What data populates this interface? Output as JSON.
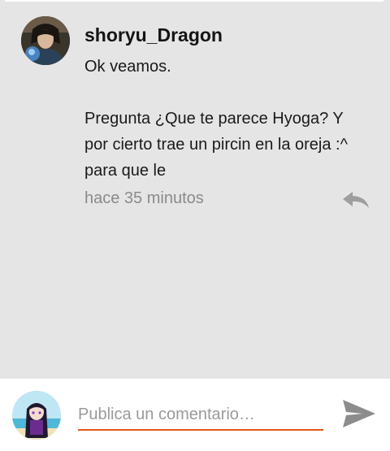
{
  "comment": {
    "username": "shoryu_Dragon",
    "lines": [
      "Ok veamos.",
      "",
      "Pregunta ¿Que te parece Hyoga? Y por cierto trae un pircin en la oreja :^ para que le"
    ],
    "timestamp": "hace 35 minutos",
    "reply_icon": "reply-arrow-icon"
  },
  "composer": {
    "placeholder": "Publica un comentario…",
    "value": "",
    "send_icon": "send-icon"
  },
  "colors": {
    "background": "#e5e5e5",
    "accent": "#e2571c",
    "muted_text": "#8a8a8a",
    "icon_gray": "#9e9e9e",
    "send_gray": "#8c8c8c"
  }
}
